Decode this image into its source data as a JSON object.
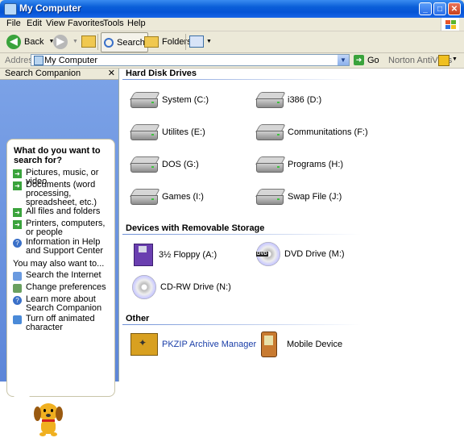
{
  "window": {
    "title": "My Computer"
  },
  "menubar": {
    "items": [
      "File",
      "Edit",
      "View",
      "Favorites",
      "Tools",
      "Help"
    ]
  },
  "toolbar": {
    "back_label": "Back",
    "search_label": "Search",
    "folders_label": "Folders"
  },
  "addressbar": {
    "label": "Address",
    "value": "My Computer",
    "go_label": "Go",
    "norton_label": "Norton AntiVirus"
  },
  "search_companion": {
    "title": "Search Companion",
    "close_glyph": "✕",
    "question": "What do you want to search for?",
    "options": [
      "Pictures, music, or video",
      "Documents (word processing, spreadsheet, etc.)",
      "All files and folders",
      "Printers, computers, or people",
      "Information in Help and Support Center"
    ],
    "also_label": "You may also want to...",
    "also_options": [
      "Search the Internet",
      "Change preferences",
      "Learn more about Search Companion",
      "Turn off animated character"
    ]
  },
  "groups": {
    "hard_disk": {
      "title": "Hard Disk Drives",
      "items": [
        "System (C:)",
        "i386 (D:)",
        "Utilites (E:)",
        "Communitations (F:)",
        "DOS (G:)",
        "Programs (H:)",
        "Games (I:)",
        "Swap File (J:)"
      ]
    },
    "removable": {
      "title": "Devices with Removable Storage",
      "items": [
        "3½ Floppy (A:)",
        "DVD Drive (M:)",
        "CD-RW Drive (N:)"
      ],
      "dvd_tag": "DVD"
    },
    "other": {
      "title": "Other",
      "items": [
        "PKZIP Archive Manager",
        "Mobile Device"
      ]
    }
  },
  "colors": {
    "titlebar": "#0a5ed8",
    "pane_blue": "#7ba2e7",
    "link_blue": "#1a3ea8"
  }
}
